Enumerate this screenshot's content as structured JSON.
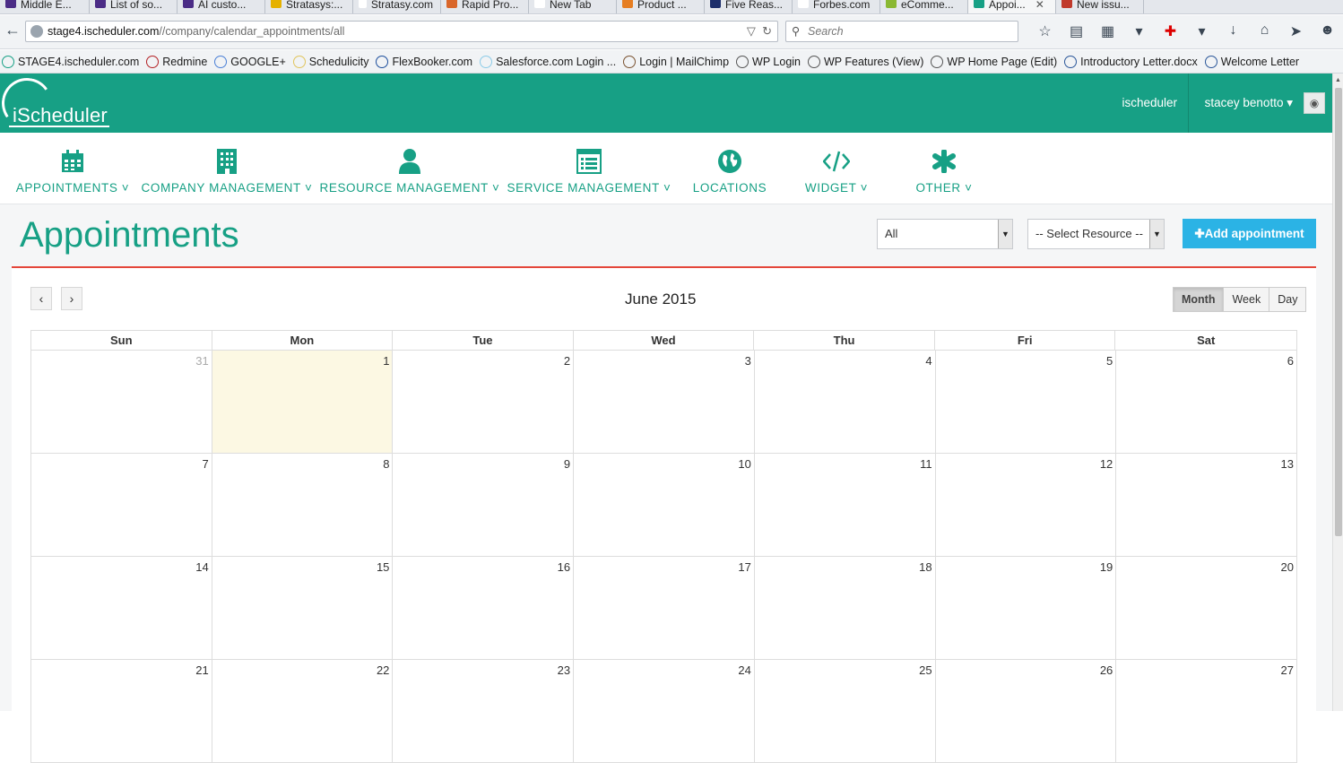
{
  "browser": {
    "tabs": [
      {
        "label": "Middle E...",
        "color": "#4b2c86"
      },
      {
        "label": "List of so...",
        "color": "#4b2c86"
      },
      {
        "label": "AI custo...",
        "color": "#4b2c86"
      },
      {
        "label": "Stratasys:...",
        "color": "#e5b100"
      },
      {
        "label": "Stratasy.com",
        "color": "#ffffff"
      },
      {
        "label": "Rapid Pro...",
        "color": "#d9662a"
      },
      {
        "label": "New Tab",
        "color": "#ffffff"
      },
      {
        "label": "Product ...",
        "color": "#e67e22"
      },
      {
        "label": "Five Reas...",
        "color": "#1c2e6b"
      },
      {
        "label": "Forbes.com",
        "color": "#ffffff"
      },
      {
        "label": "eComme...",
        "color": "#8ab833"
      },
      {
        "label": "Appoi...",
        "color": "#17a085",
        "active": true
      },
      {
        "label": "New issu...",
        "color": "#c0392b"
      }
    ],
    "url_host": "stage4.ischeduler.com",
    "url_path": "//company/calendar_appointments/all",
    "search_placeholder": "Search",
    "bookmarks": [
      {
        "label": "STAGE4.ischeduler.com",
        "color": "#17a085"
      },
      {
        "label": "Redmine",
        "color": "#b32024"
      },
      {
        "label": "GOOGLE+",
        "color": "#4a7fd6"
      },
      {
        "label": "Schedulicity",
        "color": "#e0c45c"
      },
      {
        "label": "FlexBooker.com",
        "color": "#1c4e9c"
      },
      {
        "label": "Salesforce.com Login ...",
        "color": "#8ccbe8"
      },
      {
        "label": "Login | MailChimp",
        "color": "#7a5230"
      },
      {
        "label": "WP Login",
        "color": "#555555"
      },
      {
        "label": "WP Features (View)",
        "color": "#555555"
      },
      {
        "label": "WP Home Page (Edit)",
        "color": "#555555"
      },
      {
        "label": "Introductory Letter.docx",
        "color": "#2a5699"
      },
      {
        "label": "Welcome Letter",
        "color": "#2a5699"
      }
    ]
  },
  "header": {
    "logo_text": "iScheduler",
    "company_link": "ischeduler",
    "user_name": "stacey benotto",
    "brand_color": "#17a085"
  },
  "nav": [
    {
      "label": "APPOINTMENTS",
      "icon": "calendar-icon",
      "dropdown": true
    },
    {
      "label": "COMPANY MANAGEMENT",
      "icon": "building-icon",
      "dropdown": true
    },
    {
      "label": "RESOURCE MANAGEMENT",
      "icon": "user-icon",
      "dropdown": true
    },
    {
      "label": "SERVICE MANAGEMENT",
      "icon": "list-icon",
      "dropdown": true
    },
    {
      "label": "LOCATIONS",
      "icon": "globe-icon",
      "dropdown": false
    },
    {
      "label": "WIDGET",
      "icon": "code-icon",
      "dropdown": true
    },
    {
      "label": "OTHER",
      "icon": "asterisk-icon",
      "dropdown": true
    }
  ],
  "page": {
    "title": "Appointments",
    "filter_value": "All",
    "resource_value": "-- Select Resource --",
    "add_label": "Add appointment",
    "accent_color": "#e4463a",
    "button_color": "#2bb3e5"
  },
  "calendar": {
    "title": "June 2015",
    "prev_label": "‹",
    "next_label": "›",
    "views": [
      {
        "label": "Month",
        "active": true
      },
      {
        "label": "Week",
        "active": false
      },
      {
        "label": "Day",
        "active": false
      }
    ],
    "day_names": [
      "Sun",
      "Mon",
      "Tue",
      "Wed",
      "Thu",
      "Fri",
      "Sat"
    ],
    "weeks": [
      [
        {
          "n": "31",
          "other": true
        },
        {
          "n": "1",
          "today": true
        },
        {
          "n": "2"
        },
        {
          "n": "3"
        },
        {
          "n": "4"
        },
        {
          "n": "5"
        },
        {
          "n": "6"
        }
      ],
      [
        {
          "n": "7"
        },
        {
          "n": "8"
        },
        {
          "n": "9"
        },
        {
          "n": "10"
        },
        {
          "n": "11"
        },
        {
          "n": "12"
        },
        {
          "n": "13"
        }
      ],
      [
        {
          "n": "14"
        },
        {
          "n": "15"
        },
        {
          "n": "16"
        },
        {
          "n": "17"
        },
        {
          "n": "18"
        },
        {
          "n": "19"
        },
        {
          "n": "20"
        }
      ],
      [
        {
          "n": "21"
        },
        {
          "n": "22"
        },
        {
          "n": "23"
        },
        {
          "n": "24"
        },
        {
          "n": "25"
        },
        {
          "n": "26"
        },
        {
          "n": "27"
        }
      ]
    ]
  }
}
